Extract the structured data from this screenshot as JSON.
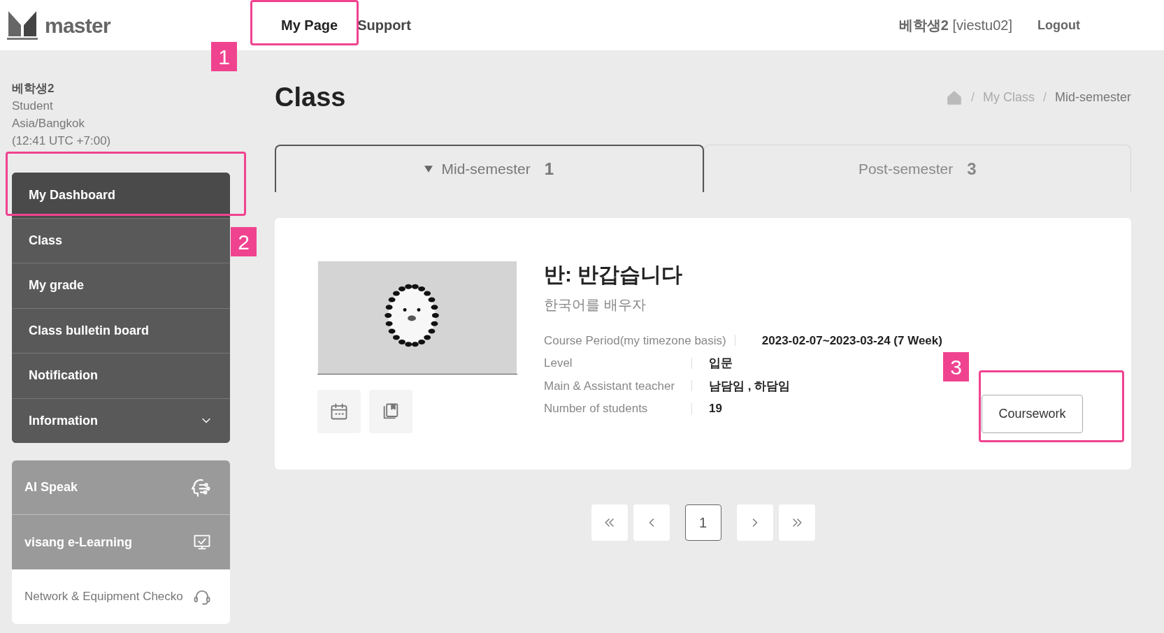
{
  "header": {
    "logo_text": "master",
    "nav": [
      {
        "label": "My Page",
        "selected": true
      },
      {
        "label": "Support",
        "selected": false
      }
    ],
    "user_name": "베학생2",
    "user_id": "[viestu02]",
    "logout": "Logout"
  },
  "profile": {
    "name": "베학생2",
    "role": "Student",
    "timezone": "Asia/Bangkok",
    "time": "(12:41 UTC +7:00)"
  },
  "sidebar": {
    "items": [
      {
        "label": "My Dashboard",
        "selected": true,
        "expandable": false
      },
      {
        "label": "Class",
        "selected": false,
        "expandable": false
      },
      {
        "label": "My grade",
        "selected": false,
        "expandable": false
      },
      {
        "label": "Class bulletin board",
        "selected": false,
        "expandable": false
      },
      {
        "label": "Notification",
        "selected": false,
        "expandable": false
      },
      {
        "label": "Information",
        "selected": false,
        "expandable": true
      }
    ],
    "links": [
      {
        "label": "AI Speak",
        "kind": "ai"
      },
      {
        "label": "visang e-Learning",
        "kind": "elearning"
      },
      {
        "label": "Network & Equipment Checko",
        "kind": "network"
      }
    ]
  },
  "page": {
    "title": "Class",
    "breadcrumb": [
      "My Class",
      "Mid-semester"
    ],
    "separator": "/"
  },
  "tabs": [
    {
      "label": "Mid-semester",
      "count": "1",
      "selected": true
    },
    {
      "label": "Post-semester",
      "count": "3",
      "selected": false
    }
  ],
  "class_card": {
    "title": "반: 반갑습니다",
    "subtitle": "한국어를 배우자",
    "details": [
      {
        "label": "Course Period(my timezone basis)",
        "value": "2023-02-07~2023-03-24  (7 Week)"
      },
      {
        "label": "Level",
        "value": "입문"
      },
      {
        "label": "Main & Assistant teacher",
        "value": "남담임 , 하담임"
      },
      {
        "label": "Number of students",
        "value": "19"
      }
    ],
    "button": "Coursework"
  },
  "pagination": {
    "pages": [
      {
        "label": "1",
        "selected": true
      }
    ]
  },
  "annotations": [
    {
      "label": "1"
    },
    {
      "label": "2"
    },
    {
      "label": "3"
    }
  ]
}
